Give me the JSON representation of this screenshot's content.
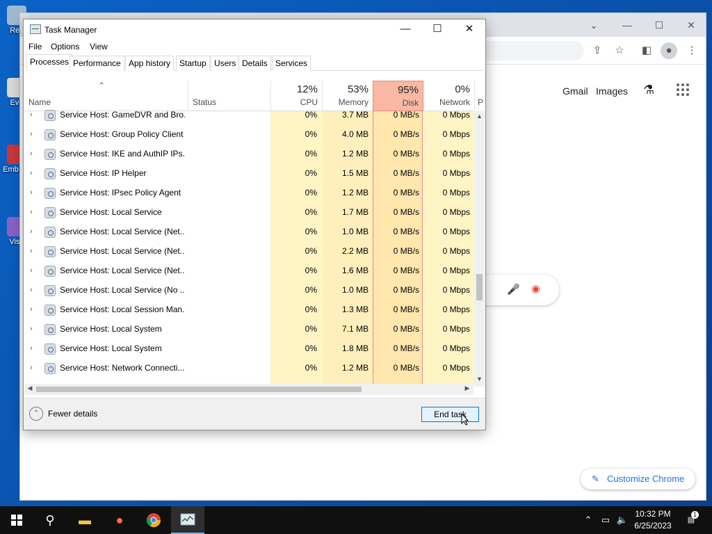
{
  "desktop": {
    "icons": [
      {
        "label": "Rec",
        "color": "#9fb9cf"
      },
      {
        "label": "Eve",
        "color": "#d9d9d9"
      },
      {
        "label": "Emb De",
        "color": "#c8383a"
      },
      {
        "label": "Visu",
        "color": "#8a60c8"
      }
    ]
  },
  "chrome": {
    "links": [
      "Gmail",
      "Images"
    ],
    "customize_label": "Customize Chrome",
    "colors": {
      "accent": "#1a73e8"
    }
  },
  "taskmanager": {
    "title": "Task Manager",
    "menu": [
      "File",
      "Options",
      "View"
    ],
    "tabs": [
      "Processes",
      "Performance",
      "App history",
      "Startup",
      "Users",
      "Details",
      "Services"
    ],
    "columns": {
      "name": "Name",
      "status": "Status",
      "cpu": {
        "pct": "12%",
        "label": "CPU"
      },
      "memory": {
        "pct": "53%",
        "label": "Memory"
      },
      "disk": {
        "pct": "95%",
        "label": "Disk"
      },
      "network": {
        "pct": "0%",
        "label": "Network"
      },
      "power": "P"
    },
    "rows": [
      {
        "name": "Service Host: GameDVR and Bro...",
        "cpu": "0%",
        "memory": "3.7 MB",
        "disk": "0 MB/s",
        "network": "0 Mbps"
      },
      {
        "name": "Service Host: Group Policy Client",
        "cpu": "0%",
        "memory": "4.0 MB",
        "disk": "0 MB/s",
        "network": "0 Mbps"
      },
      {
        "name": "Service Host: IKE and AuthIP IPs...",
        "cpu": "0%",
        "memory": "1.2 MB",
        "disk": "0 MB/s",
        "network": "0 Mbps"
      },
      {
        "name": "Service Host: IP Helper",
        "cpu": "0%",
        "memory": "1.5 MB",
        "disk": "0 MB/s",
        "network": "0 Mbps"
      },
      {
        "name": "Service Host: IPsec Policy Agent",
        "cpu": "0%",
        "memory": "1.2 MB",
        "disk": "0 MB/s",
        "network": "0 Mbps"
      },
      {
        "name": "Service Host: Local Service",
        "cpu": "0%",
        "memory": "1.7 MB",
        "disk": "0 MB/s",
        "network": "0 Mbps"
      },
      {
        "name": "Service Host: Local Service (Net...",
        "cpu": "0%",
        "memory": "1.0 MB",
        "disk": "0 MB/s",
        "network": "0 Mbps"
      },
      {
        "name": "Service Host: Local Service (Net...",
        "cpu": "0%",
        "memory": "2.2 MB",
        "disk": "0 MB/s",
        "network": "0 Mbps"
      },
      {
        "name": "Service Host: Local Service (Net...",
        "cpu": "0%",
        "memory": "1.6 MB",
        "disk": "0 MB/s",
        "network": "0 Mbps"
      },
      {
        "name": "Service Host: Local Service (No ...",
        "cpu": "0%",
        "memory": "1.0 MB",
        "disk": "0 MB/s",
        "network": "0 Mbps"
      },
      {
        "name": "Service Host: Local Session Man...",
        "cpu": "0%",
        "memory": "1.3 MB",
        "disk": "0 MB/s",
        "network": "0 Mbps"
      },
      {
        "name": "Service Host: Local System",
        "cpu": "0%",
        "memory": "7.1 MB",
        "disk": "0 MB/s",
        "network": "0 Mbps"
      },
      {
        "name": "Service Host: Local System",
        "cpu": "0%",
        "memory": "1.8 MB",
        "disk": "0 MB/s",
        "network": "0 Mbps"
      },
      {
        "name": "Service Host: Network Connecti...",
        "cpu": "0%",
        "memory": "1.2 MB",
        "disk": "0 MB/s",
        "network": "0 Mbps"
      }
    ],
    "footer": {
      "fewer_details": "Fewer details",
      "end_task": "End task"
    },
    "colors": {
      "col_light": "#fff8d6",
      "col_mid": "#fff1bf",
      "disk_header": "#f9b8a4",
      "disk_col": "#ffe8b0",
      "disk_border": "#e88a73"
    }
  },
  "taskbar": {
    "icons": [
      "start-icon",
      "search-icon",
      "file-explorer-icon",
      "firefox-icon",
      "chrome-icon",
      "task-manager-icon"
    ],
    "clock": {
      "time": "10:32 PM",
      "date": "6/25/2023"
    },
    "notification_count": "1"
  }
}
